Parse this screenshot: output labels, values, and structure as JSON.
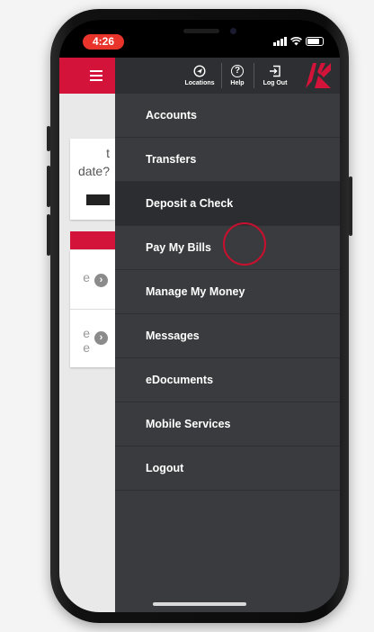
{
  "status": {
    "time": "4:26"
  },
  "top_actions": [
    {
      "label": "Locations",
      "icon": "location-icon"
    },
    {
      "label": "Help",
      "icon": "help-icon"
    },
    {
      "label": "Log Out",
      "icon": "logout-icon"
    }
  ],
  "menu": {
    "items": [
      {
        "label": "Accounts"
      },
      {
        "label": "Transfers"
      },
      {
        "label": "Deposit a Check",
        "active": true
      },
      {
        "label": "Pay My Bills"
      },
      {
        "label": "Manage My Money"
      },
      {
        "label": "Messages"
      },
      {
        "label": "eDocuments"
      },
      {
        "label": "Mobile Services"
      },
      {
        "label": "Logout"
      }
    ]
  },
  "background_panel": {
    "fragment_1": "t",
    "fragment_2": "date?",
    "fragment_3": "e",
    "fragment_4": "e",
    "fragment_5": "e"
  },
  "colors": {
    "brand_red": "#d3133a",
    "menu_bg": "#3a3b3e",
    "menu_top_bg": "#2e2f32",
    "highlight_ring": "#c8102e"
  }
}
